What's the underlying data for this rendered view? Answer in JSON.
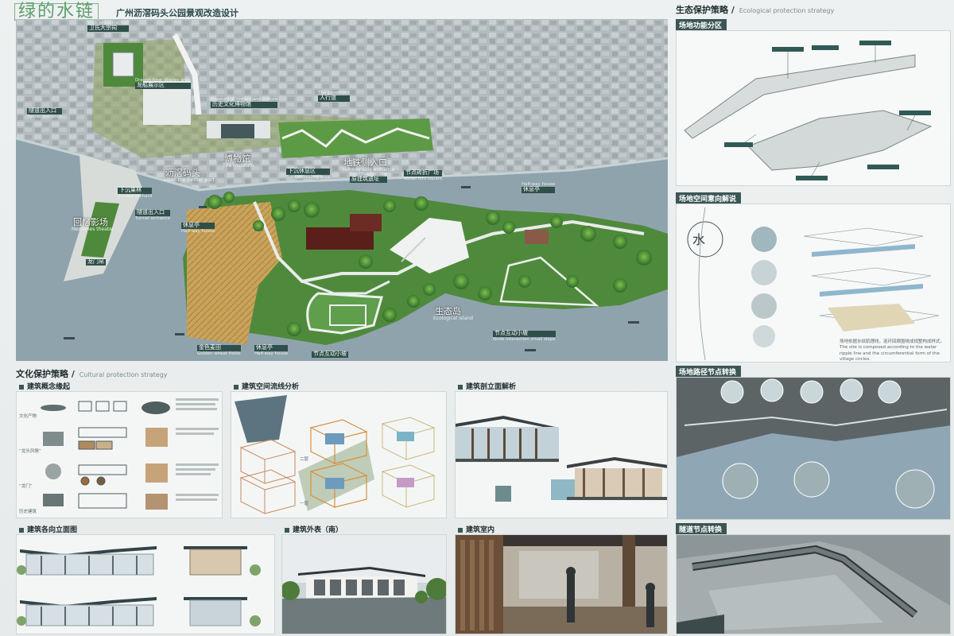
{
  "header": {
    "brand": "绿的水链",
    "title": "广州沥滘码头公园景观改造设计"
  },
  "plan_labels": {
    "weiancestral_en": "Weis ancestral hall",
    "weiancestral_cn": "卫氏大宗祠",
    "dragon_en": "Dragon boat display area",
    "dragon_cn": "龙船展示区",
    "tunnel_cn": "隧道出入口",
    "tunnel_en": "Tunnel entrance",
    "museum_en": "Museum of history and culture",
    "museum_cn": "历史文化博物馆",
    "pavement_en": "The pavement",
    "pavement_cn": "人行道",
    "bowuguan_cn": "博物馆",
    "bowuguan_en": "The museum",
    "xiachen_cn": "下沉休息区",
    "xiachen_en": "Sunken resting area",
    "subway_cn": "地铁侧入口",
    "subway_en": "Subway side entrance",
    "construction_en": "Construction site",
    "yuanjian_cn": "原建筑遗址",
    "jiedian_cn": "节点砖折广场",
    "jiedian_en": "Nodal fold square",
    "xiuxiting1_en": "Half-way house",
    "xiuxiting1_cn": "休息亭",
    "lijiao_cn": "沥滘码头",
    "lijiao_en": "Lijiao the former port",
    "guolin_cn": "下沉果林",
    "guolin_en": "Sunken orchard",
    "tunnel2_cn": "隧道出入口",
    "tunnel2_en": "Tunnel entrance",
    "memory_cn": "回忆影场",
    "memory_en": "Memories theater",
    "xiuxiting2_cn": "休息亭",
    "xiuxiting2_en": "Half-way house",
    "longmen_cn": "龙门帛",
    "shengtai_cn": "生态岛",
    "shengtai_en": "Ecological island",
    "hudong_cn": "节点互动小坡",
    "hudong_en": "Node interaction small slope",
    "maitian_cn": "金色麦田",
    "maitian_en": "Golden wheat fields",
    "xiuxiting3_cn": "休息亭",
    "xiuxiting3_en": "Half-way house",
    "hudong2_cn": "节点互动小坡",
    "hudong2_en": "Node interaction small slope"
  },
  "culture": {
    "title": "文化保护策略",
    "title_en": "Cultural protection strategy",
    "concept": "建筑概念缘起",
    "flow": "建筑空间流线分析",
    "section": "建筑剖立面解析",
    "elev": "建筑各向立面图",
    "exterior": "建筑外表（南）",
    "interior": "建筑室内",
    "concept_rows": [
      "文化产物",
      "“龙头风情”",
      "“龙门”",
      "历史建筑"
    ],
    "floor1": "一层",
    "floor2": "二层"
  },
  "eco": {
    "title": "生态保护策略",
    "title_en": "Ecological protection strategy",
    "function": "场地功能分区",
    "intent": "场地空间意向解说",
    "node": "场地路径节点转换",
    "tunnel": "隧道节点转换",
    "water_char": "水",
    "intent_caption": "场地依据水纹肌理线，连环回廊围绕成规整构成样式。",
    "intent_caption_en": "The site is composed according to the water ripple line and the circumferential form of the village circles."
  },
  "colors": {
    "accent": "#3b5655",
    "water": "#8fa3ad",
    "green": "#4f8a3c",
    "brand": "#5b9e6b"
  }
}
